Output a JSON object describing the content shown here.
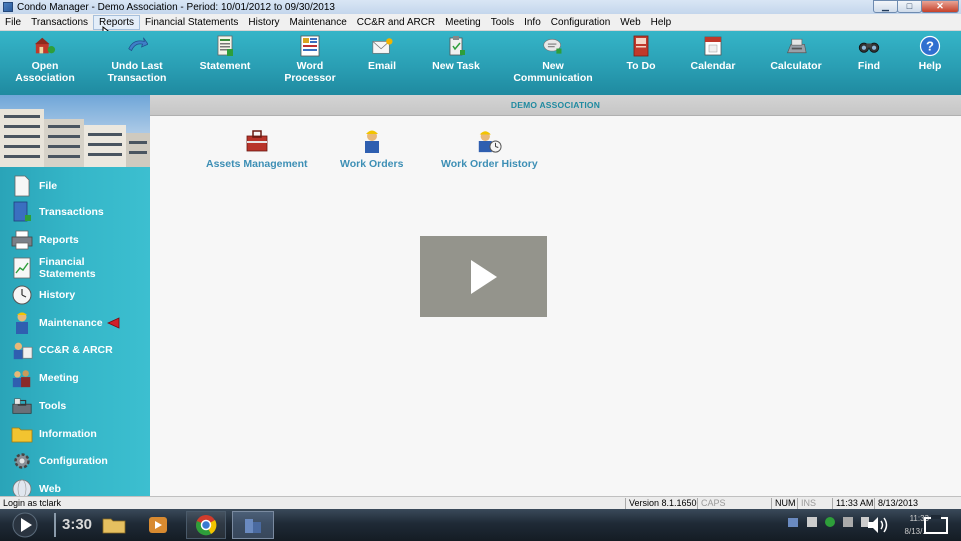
{
  "window": {
    "title": "Condo Manager - Demo Association - Period: 10/01/2012 to 09/30/2013",
    "minimize": "▁",
    "maximize": "□",
    "close": "✕"
  },
  "menu": [
    "File",
    "Transactions",
    "Reports",
    "Financial Statements",
    "History",
    "Maintenance",
    "CC&R and ARCR",
    "Meeting",
    "Tools",
    "Info",
    "Configuration",
    "Web",
    "Help"
  ],
  "toolbar": {
    "open_association": [
      "Open",
      "Association"
    ],
    "undo_last": [
      "Undo Last",
      "Transaction"
    ],
    "statement": [
      "Statement"
    ],
    "word_processor": [
      "Word",
      "Processor"
    ],
    "email": [
      "Email"
    ],
    "new_task": [
      "New Task"
    ],
    "new_communication": [
      "New",
      "Communication"
    ],
    "todo": [
      "To Do"
    ],
    "calendar": [
      "Calendar"
    ],
    "calculator": [
      "Calculator"
    ],
    "find": [
      "Find"
    ],
    "help": [
      "Help"
    ]
  },
  "sidebar": {
    "items": [
      {
        "label": "File"
      },
      {
        "label": "Transactions"
      },
      {
        "label": "Reports"
      },
      {
        "label_lines": [
          "Financial",
          "Statements"
        ]
      },
      {
        "label": "History"
      },
      {
        "label": "Maintenance"
      },
      {
        "label": "CC&R & ARCR"
      },
      {
        "label": "Meeting"
      },
      {
        "label": "Tools"
      },
      {
        "label": "Information"
      },
      {
        "label": "Configuration"
      },
      {
        "label": "Web"
      }
    ]
  },
  "main": {
    "header": "DEMO ASSOCIATION",
    "modules": [
      "Assets Management",
      "Work Orders",
      "Work Order History"
    ]
  },
  "status": {
    "login": "Login as tclark",
    "version": "Version 8.1.1650",
    "caps": "CAPS",
    "num": "NUM",
    "ins": "INS",
    "time": "11:33 AM",
    "date": "8/13/2013"
  },
  "player": {
    "elapsed": "3:30",
    "clock_time": "11:33",
    "clock_date": "8/13/..."
  },
  "colors": {
    "accent": "#2a9fb4",
    "module_text": "#3d8fb5"
  }
}
